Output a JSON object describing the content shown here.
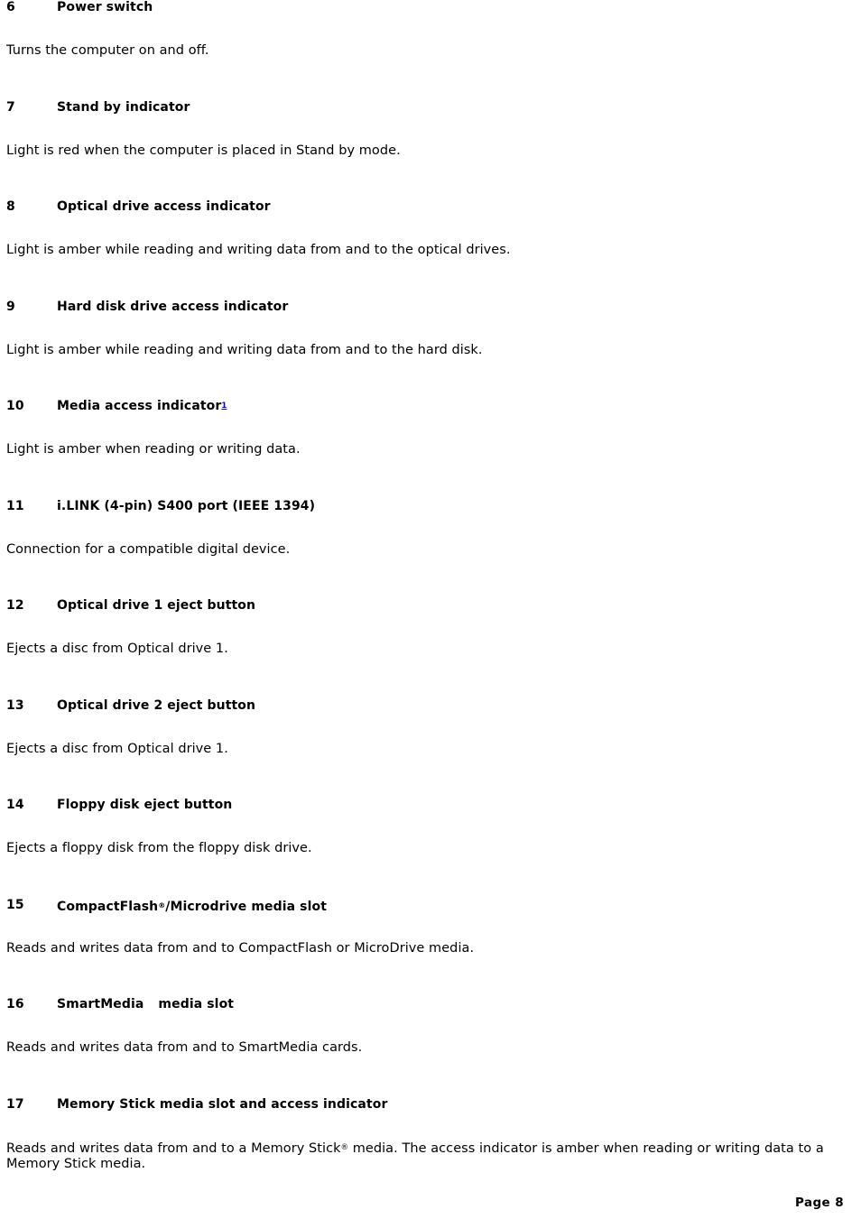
{
  "document": {
    "page_label": "Page 8",
    "footnote_marker": "1",
    "footnote_marker_color": "#0000cc",
    "registered_symbol": "®",
    "items": [
      {
        "number": "6",
        "title": "Power switch",
        "body": "Turns the computer on and off."
      },
      {
        "number": "7",
        "title": "Stand by indicator",
        "body": "Light is red when the computer is placed in Stand by mode."
      },
      {
        "number": "8",
        "title": "Optical drive access indicator",
        "body": "Light is amber while reading and writing data from and to the optical drives."
      },
      {
        "number": "9",
        "title": "Hard disk drive access indicator",
        "body": "Light is amber while reading and writing data from and to the hard disk."
      },
      {
        "number": "10",
        "title": "Media access indicator",
        "title_suffix_footnote": "1",
        "body": "Light is amber when reading or writing data."
      },
      {
        "number": "11",
        "title": "i.LINK (4-pin) S400 port (IEEE 1394)",
        "body": "Connection for a compatible digital device."
      },
      {
        "number": "12",
        "title": "Optical drive 1 eject button",
        "body": "Ejects a disc from Optical drive 1."
      },
      {
        "number": "13",
        "title": "Optical drive 2 eject button",
        "body": "Ejects a disc from Optical drive 1."
      },
      {
        "number": "14",
        "title": "Floppy disk eject button",
        "body": "Ejects a floppy disk from the floppy disk drive."
      },
      {
        "number": "15",
        "title_part1": "CompactFlash",
        "title_symbol": "®",
        "title_part2": "/Microdrive media slot",
        "body": "Reads and writes data from and to CompactFlash or MicroDrive media."
      },
      {
        "number": "16",
        "title_part1": "SmartMedia",
        "title_part2": "media slot",
        "body": "Reads and writes data from and to SmartMedia cards."
      },
      {
        "number": "17",
        "title": "Memory Stick media slot and access indicator",
        "body_part1": "Reads and writes data from and to a Memory Stick",
        "body_symbol": "®",
        "body_part2": " media. The access indicator is amber when reading or writing data to a Memory Stick media."
      }
    ]
  }
}
